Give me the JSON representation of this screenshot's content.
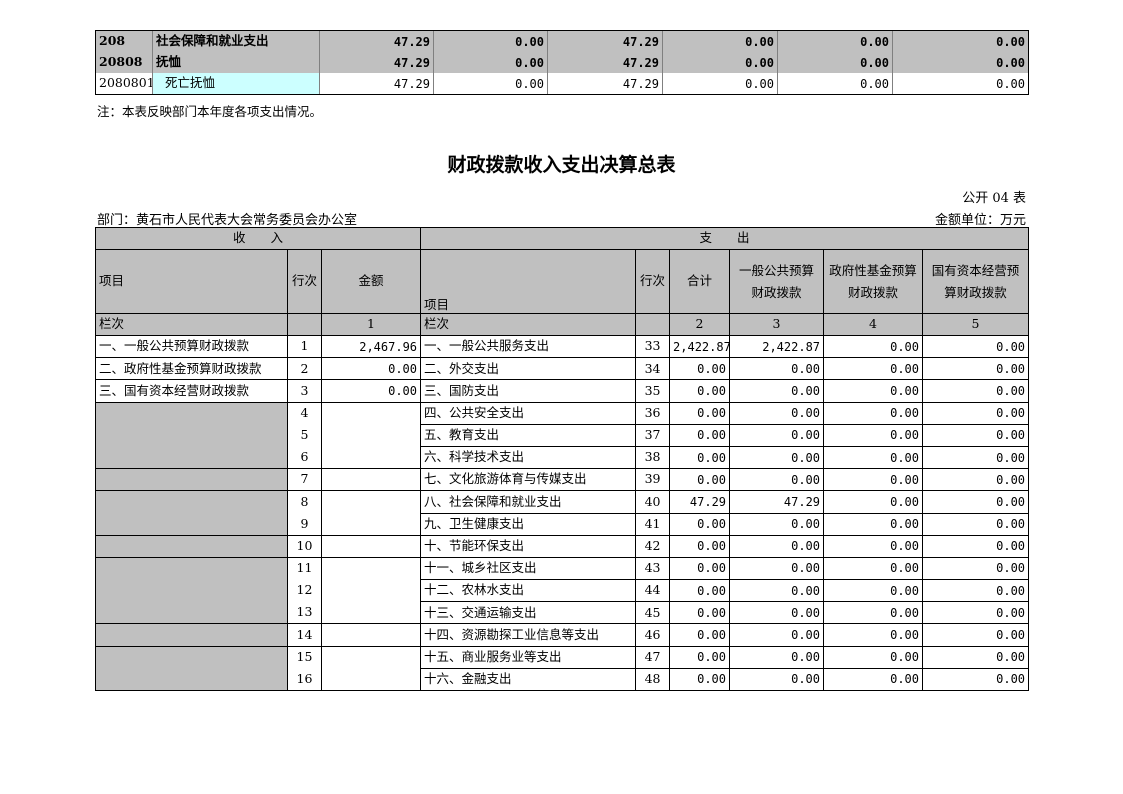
{
  "top_rows": [
    {
      "code": "208",
      "name": "社会保障和就业支出",
      "v1": "47.29",
      "v2": "0.00",
      "v3": "47.29",
      "v4": "0.00",
      "v5": "0.00",
      "v6": "0.00"
    },
    {
      "code": "20808",
      "name": "抚恤",
      "v1": "47.29",
      "v2": "0.00",
      "v3": "47.29",
      "v4": "0.00",
      "v5": "0.00",
      "v6": "0.00"
    },
    {
      "code": "2080801",
      "name": "死亡抚恤",
      "v1": "47.29",
      "v2": "0.00",
      "v3": "47.29",
      "v4": "0.00",
      "v5": "0.00",
      "v6": "0.00"
    }
  ],
  "note": "注：本表反映部门本年度各项支出情况。",
  "title": "财政拨款收入支出决算总表",
  "form_no": "公开 04 表",
  "department": "部门：黄石市人民代表大会常务委员会办公室",
  "unit": "金额单位：万元",
  "headers": {
    "income": "收　　入",
    "expense": "支　　出",
    "item": "项目",
    "row_no": "行次",
    "amount": "金额",
    "item2": "项目",
    "row_no2": "行次",
    "total": "合计",
    "general_budget": "一般公共预算财政拨款",
    "gov_fund": "政府性基金预算财政拨款",
    "state_capital": "国有资本经营预算财政拨款"
  },
  "lanci_row": {
    "label": "栏次",
    "c1": "1",
    "label2": "栏次",
    "c2": "2",
    "c3": "3",
    "c4": "4",
    "c5": "5"
  },
  "rows": [
    {
      "in_item": "一、一般公共预算财政拨款",
      "in_no": "1",
      "in_amt": "2,467.96",
      "out_item": "一、一般公共服务支出",
      "out_no": "33",
      "total": "2,422.87",
      "gen": "2,422.87",
      "fund": "0.00",
      "cap": "0.00"
    },
    {
      "in_item": "二、政府性基金预算财政拨款",
      "in_no": "2",
      "in_amt": "0.00",
      "out_item": "二、外交支出",
      "out_no": "34",
      "total": "0.00",
      "gen": "0.00",
      "fund": "0.00",
      "cap": "0.00"
    },
    {
      "in_item": "三、国有资本经营财政拨款",
      "in_no": "3",
      "in_amt": "0.00",
      "out_item": "三、国防支出",
      "out_no": "35",
      "total": "0.00",
      "gen": "0.00",
      "fund": "0.00",
      "cap": "0.00"
    },
    {
      "in_item": "",
      "in_no": "4",
      "in_amt": "",
      "out_item": "四、公共安全支出",
      "out_no": "36",
      "total": "0.00",
      "gen": "0.00",
      "fund": "0.00",
      "cap": "0.00"
    },
    {
      "in_item": "",
      "in_no": "5",
      "in_amt": "",
      "out_item": "五、教育支出",
      "out_no": "37",
      "total": "0.00",
      "gen": "0.00",
      "fund": "0.00",
      "cap": "0.00"
    },
    {
      "in_item": "",
      "in_no": "6",
      "in_amt": "",
      "out_item": "六、科学技术支出",
      "out_no": "38",
      "total": "0.00",
      "gen": "0.00",
      "fund": "0.00",
      "cap": "0.00"
    },
    {
      "in_item": "",
      "in_no": "7",
      "in_amt": "",
      "out_item": "七、文化旅游体育与传媒支出",
      "out_no": "39",
      "total": "0.00",
      "gen": "0.00",
      "fund": "0.00",
      "cap": "0.00"
    },
    {
      "in_item": "",
      "in_no": "8",
      "in_amt": "",
      "out_item": "八、社会保障和就业支出",
      "out_no": "40",
      "total": "47.29",
      "gen": "47.29",
      "fund": "0.00",
      "cap": "0.00"
    },
    {
      "in_item": "",
      "in_no": "9",
      "in_amt": "",
      "out_item": "九、卫生健康支出",
      "out_no": "41",
      "total": "0.00",
      "gen": "0.00",
      "fund": "0.00",
      "cap": "0.00"
    },
    {
      "in_item": "",
      "in_no": "10",
      "in_amt": "",
      "out_item": "十、节能环保支出",
      "out_no": "42",
      "total": "0.00",
      "gen": "0.00",
      "fund": "0.00",
      "cap": "0.00"
    },
    {
      "in_item": "",
      "in_no": "11",
      "in_amt": "",
      "out_item": "十一、城乡社区支出",
      "out_no": "43",
      "total": "0.00",
      "gen": "0.00",
      "fund": "0.00",
      "cap": "0.00"
    },
    {
      "in_item": "",
      "in_no": "12",
      "in_amt": "",
      "out_item": "十二、农林水支出",
      "out_no": "44",
      "total": "0.00",
      "gen": "0.00",
      "fund": "0.00",
      "cap": "0.00"
    },
    {
      "in_item": "",
      "in_no": "13",
      "in_amt": "",
      "out_item": "十三、交通运输支出",
      "out_no": "45",
      "total": "0.00",
      "gen": "0.00",
      "fund": "0.00",
      "cap": "0.00"
    },
    {
      "in_item": "",
      "in_no": "14",
      "in_amt": "",
      "out_item": "十四、资源勘探工业信息等支出",
      "out_no": "46",
      "total": "0.00",
      "gen": "0.00",
      "fund": "0.00",
      "cap": "0.00"
    },
    {
      "in_item": "",
      "in_no": "15",
      "in_amt": "",
      "out_item": "十五、商业服务业等支出",
      "out_no": "47",
      "total": "0.00",
      "gen": "0.00",
      "fund": "0.00",
      "cap": "0.00"
    },
    {
      "in_item": "",
      "in_no": "16",
      "in_amt": "",
      "out_item": "十六、金融支出",
      "out_no": "48",
      "total": "0.00",
      "gen": "0.00",
      "fund": "0.00",
      "cap": "0.00"
    }
  ]
}
